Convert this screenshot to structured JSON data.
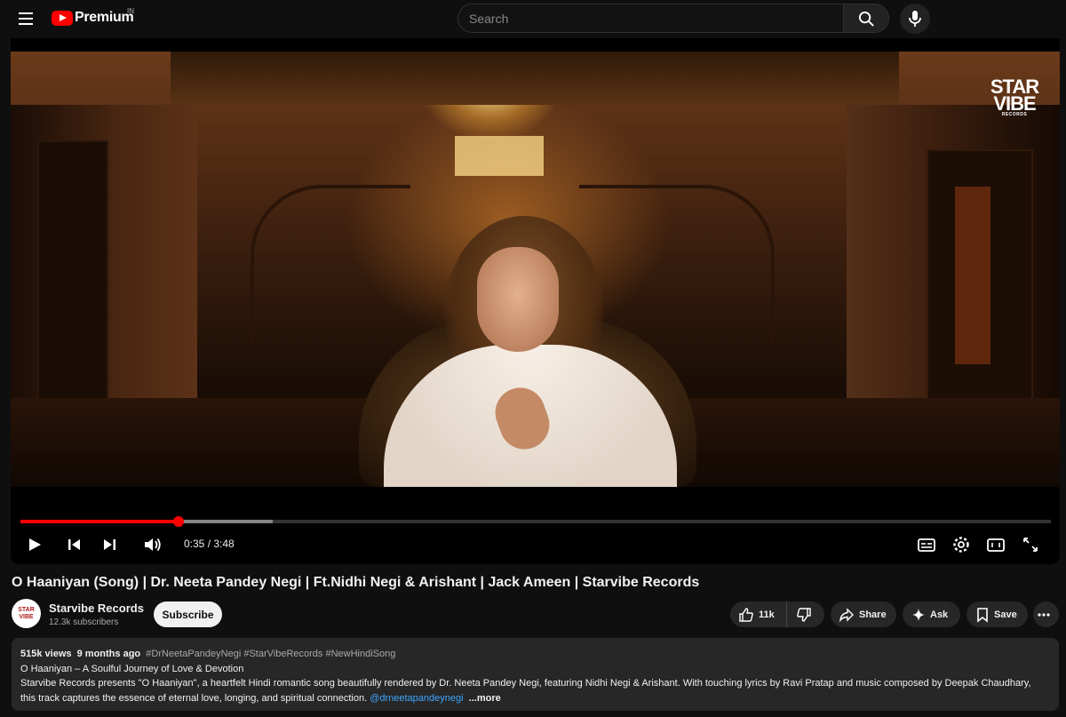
{
  "header": {
    "logo_text": "Premium",
    "country_code": "IN",
    "search_placeholder": "Search"
  },
  "player": {
    "watermark_line1": "STAR",
    "watermark_line2": "VIBE",
    "watermark_sub": "RECORDS",
    "current_time": "0:35",
    "duration": "3:48",
    "time_display": "0:35 / 3:48",
    "progress_fraction": 0.1535,
    "buffer_fraction": 0.245,
    "accent_color": "#ff0000"
  },
  "video": {
    "title": "O Haaniyan (Song) | Dr. Neeta Pandey Negi | Ft.Nidhi Negi & Arishant | Jack Ameen | Starvibe Records"
  },
  "channel": {
    "avatar_text": "STAR VIBE",
    "name": "Starvibe Records",
    "subscribers": "12.3k subscribers",
    "subscribe_label": "Subscribe"
  },
  "actions": {
    "like_count": "11k",
    "share_label": "Share",
    "ask_label": "Ask",
    "save_label": "Save"
  },
  "description": {
    "views": "515k views",
    "age": "9 months ago",
    "hashtags": "#DrNeetaPandeyNegi #StarVibeRecords #NewHindiSong",
    "line1": "O Haaniyan – A Soulful Journey of Love & Devotion",
    "line2": "Starvibe Records presents \"O Haaniyan\", a heartfelt Hindi romantic song beautifully rendered by Dr. Neeta Pandey Negi, featuring Nidhi Negi & Arishant. With touching lyrics by Ravi Pratap and music composed by Deepak Chaudhary,",
    "line3": "this track captures the essence of eternal love, longing, and spiritual connection.",
    "mention": "@drneetapandeynegi",
    "more_label": "...more"
  }
}
